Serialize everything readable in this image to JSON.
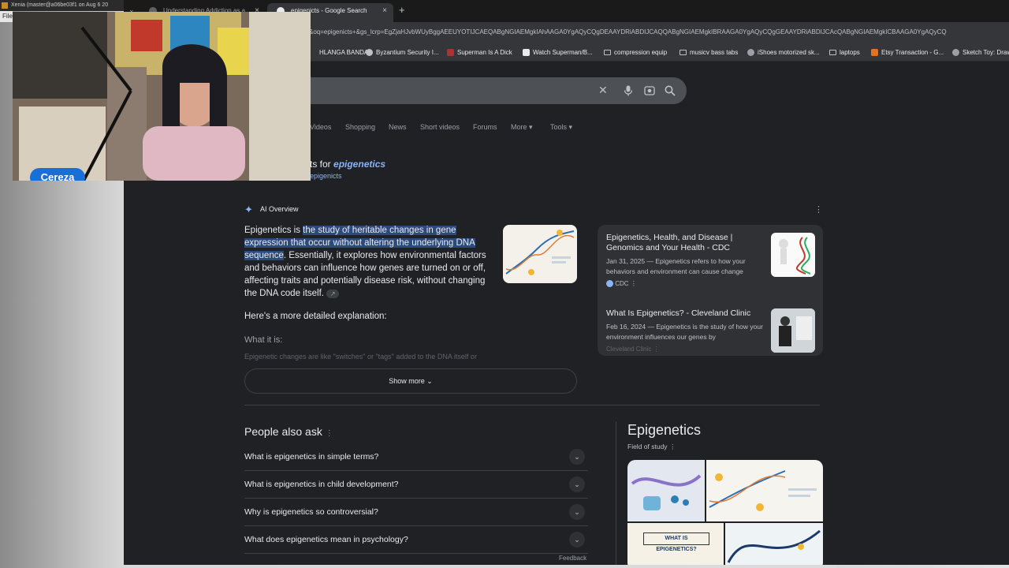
{
  "terminal": {
    "title": "Xenia (master@a06be03f1 on Aug  6 20",
    "menu": "File"
  },
  "browser": {
    "tabs": [
      {
        "title": "Understanding Addiction as a",
        "close": "×"
      },
      {
        "title": "epigenicts - Google Search",
        "close": "×"
      }
    ],
    "tab_chevron": "⌄",
    "new_tab": "+",
    "url": "&oq=epigenicts+&gs_lcrp=EgZjaHJvbWUyBggAEEUYOTIJCAEQABgNGIAEMgkIAhAAGA0YgAQyCQgDEAAYDRiABDIJCAQQABgNGIAEMgkIBRAAGA0YgAQyCQgGEAAYDRiABDIJCAcQABgNGIAEMgkICBAAGA0YgAQyCQ",
    "bookmarks": [
      {
        "label": "HLANGA BANDA",
        "icon": "bookmark-icon"
      },
      {
        "label": "Byzantium Security I...",
        "icon": "wordpress-icon"
      },
      {
        "label": "Superman Is A Dick",
        "icon": "image-icon"
      },
      {
        "label": "Watch Superman/B...",
        "icon": "page-icon"
      },
      {
        "label": "compression equip",
        "icon": "folder-icon"
      },
      {
        "label": "musicv bass tabs",
        "icon": "folder-icon"
      },
      {
        "label": "iShoes motorized sk...",
        "icon": "globe-icon"
      },
      {
        "label": "laptops",
        "icon": "folder-icon"
      },
      {
        "label": "Etsy Transaction - G...",
        "icon": "etsy-icon"
      },
      {
        "label": "Sketch Toy: Draw",
        "icon": "globe-icon"
      }
    ]
  },
  "search": {
    "clear": "✕",
    "nav_tabs": [
      "Videos",
      "Shopping",
      "News",
      "Short videos",
      "Forums",
      "More ▾",
      "Tools ▾"
    ],
    "results_for_prefix": "ts for ",
    "results_for_query": "epigenetics",
    "search_instead": "epigenicts"
  },
  "ai_overview": {
    "label": "AI Overview",
    "more": "⋮",
    "text_pre": "Epigenetics is ",
    "text_highlight": "the study of heritable changes in gene expression that occur without altering the underlying DNA sequence",
    "text_post": ". Essentially, it explores how environmental factors and behaviors can influence how genes are turned on or off, affecting traits and potentially disease risk, without changing the DNA code itself.",
    "link_icon": "🔗",
    "detail": "Here's a more detailed explanation:",
    "what_it_is": "What it is:",
    "fade_text": "Epigenetic changes are like \"switches\" or \"tags\" added to the DNA itself or",
    "show_more": "Show more ⌄"
  },
  "sources": [
    {
      "title": "Epigenetics, Health, and Disease | Genomics and Your Health - CDC",
      "meta": "Jan 31, 2025 — Epigenetics refers to how your behaviors and environment can cause change",
      "site": "CDC",
      "site_more": "⋮"
    },
    {
      "title": "What Is Epigenetics? - Cleveland Clinic",
      "meta": "Feb 16, 2024 — Epigenetics is the study of how your environment influences our genes by",
      "site": "Cleveland Clinic",
      "site_more": "⋮"
    }
  ],
  "paa": {
    "title": "People also ask",
    "more": "⋮",
    "questions": [
      "What is epigenetics in simple terms?",
      "What is epigenetics in child development?",
      "Why is epigenetics so controversial?",
      "What does epigenetics mean in psychology?"
    ],
    "chevron": "⌄",
    "feedback": "Feedback"
  },
  "knowledge_panel": {
    "title": "Epigenetics",
    "subtitle": "Field of study",
    "sub_more": "⋮",
    "img_caption": "WHAT IS EPIGENETICS?"
  },
  "webcam": {
    "name": "Cereza"
  },
  "colors": {
    "browser_bg": "#202124",
    "link": "#8ab4f8",
    "highlight": "#2d4a7c",
    "badge": "#1a6ed8"
  }
}
